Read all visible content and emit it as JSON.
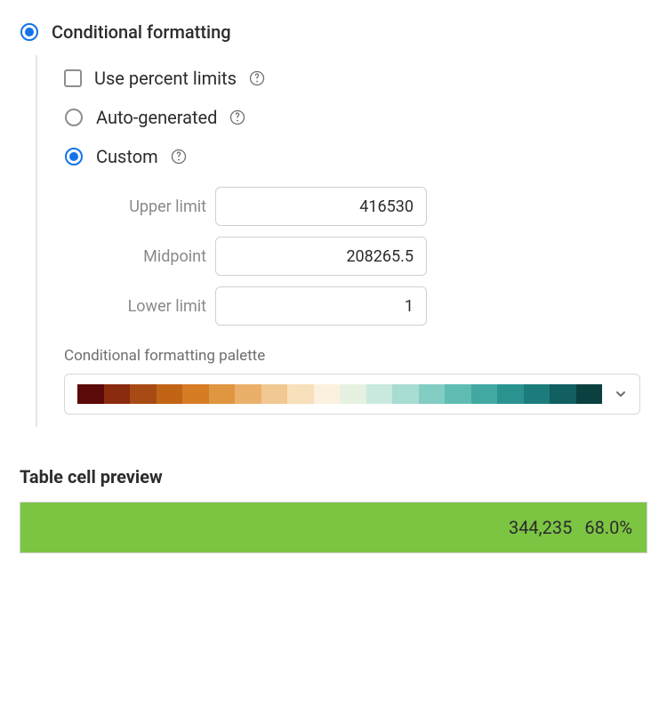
{
  "section": {
    "title": "Conditional formatting"
  },
  "options": {
    "use_percent_limits_label": "Use percent limits",
    "auto_generated_label": "Auto-generated",
    "custom_label": "Custom"
  },
  "limits": {
    "upper_label": "Upper limit",
    "upper_value": "416530",
    "midpoint_label": "Midpoint",
    "midpoint_value": "208265.5",
    "lower_label": "Lower limit",
    "lower_value": "1"
  },
  "palette": {
    "label": "Conditional formatting palette",
    "swatches": [
      "#5c0909",
      "#8a2a0e",
      "#a84a14",
      "#c26416",
      "#d57c24",
      "#e09540",
      "#eab06a",
      "#f1c892",
      "#f7e0bb",
      "#fbf1de",
      "#e6f1e2",
      "#c9e9df",
      "#a7ddd3",
      "#82cdc3",
      "#5fbcb2",
      "#41a9a1",
      "#2a938f",
      "#1c7c7b",
      "#115f60",
      "#0a4040"
    ]
  },
  "preview": {
    "title": "Table cell preview",
    "value": "344,235",
    "percent": "68.0%",
    "bg_color": "#7cc543"
  }
}
